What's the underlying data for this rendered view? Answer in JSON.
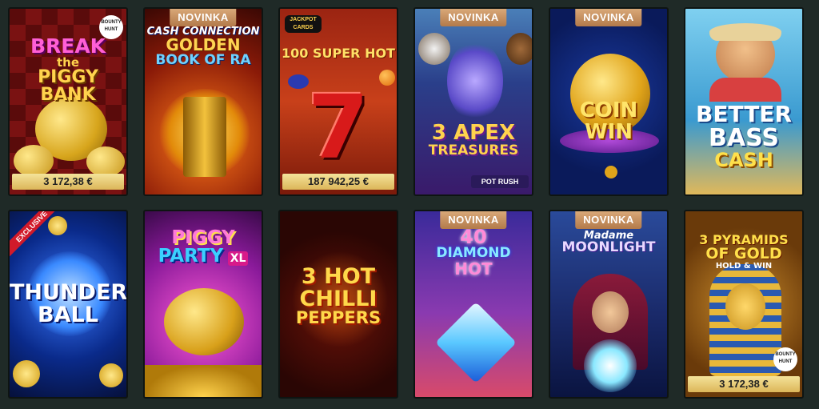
{
  "games": [
    {
      "title": "BREAK the PIGGY BANK",
      "badge": "",
      "jackpot": "3 172,38 €",
      "logo": "BOUNTY HUNT"
    },
    {
      "title": "CASH CONNECTION GOLDEN BOOK OF RA",
      "badge": "NOVINKA",
      "jackpot": "",
      "logo": ""
    },
    {
      "title": "100 SUPER HOT",
      "badge": "",
      "jackpot": "187 942,25 €",
      "logo": "JACKPOT CARDS"
    },
    {
      "title": "3 APEX TREASURES",
      "badge": "NOVINKA",
      "jackpot": "",
      "logo": "POT RUSH"
    },
    {
      "title": "COIN WIN",
      "badge": "NOVINKA",
      "jackpot": "",
      "logo": ""
    },
    {
      "title": "BETTER BASS CASH",
      "badge": "",
      "jackpot": "",
      "logo": ""
    },
    {
      "title": "THUNDER BALL",
      "badge": "",
      "jackpot": "",
      "logo": "",
      "ribbon": "EXCLUSIVE"
    },
    {
      "title": "PIGGY PARTY XL",
      "badge": "",
      "jackpot": "",
      "logo": ""
    },
    {
      "title": "3 HOT CHILLI PEPPERS",
      "badge": "",
      "jackpot": "",
      "logo": ""
    },
    {
      "title": "40 DIAMOND HOT",
      "badge": "NOVINKA",
      "jackpot": "",
      "logo": ""
    },
    {
      "title": "Madame MOONLIGHT",
      "badge": "NOVINKA",
      "jackpot": "",
      "logo": ""
    },
    {
      "title": "3 PYRAMIDS OF GOLD HOLD & WIN",
      "badge": "",
      "jackpot": "3 172,38 €",
      "logo": "BOUNTY HUNT"
    }
  ],
  "texts": {
    "g0_line1": "BREAK",
    "g0_line2": "the",
    "g0_line3": "PIGGY BANK",
    "g0_logo": "BOUNTY HUNT",
    "g1_line1": "CASH CONNECTION",
    "g1_line2": "GOLDEN",
    "g1_line3": "BOOK OF RA",
    "g2_logo": "JACKPOT CARDS",
    "g2_line1": "100 SUPER HOT",
    "g2_seven": "7",
    "g3_line1": "3 APEX",
    "g3_line2": "TREASURES",
    "g3_logo": "POT RUSH",
    "g4_line1": "COIN",
    "g4_line2": "WIN",
    "g5_line1": "BETTER",
    "g5_line2": "BASS",
    "g5_line3": "CASH",
    "g6_ribbon": "EXCLUSIVE",
    "g6_line1": "THUNDER",
    "g6_line2": "BALL",
    "g7_line1": "PIGGY",
    "g7_line2": "PARTY",
    "g7_line3": "XL",
    "g8_line1": "3 HOT",
    "g8_line2": "CHILLI",
    "g8_line3": "PEPPERS",
    "g9_line1": "40",
    "g9_line2": "DIAMOND",
    "g9_line3": "HOT",
    "g10_line1": "Madame",
    "g10_line2": "MOONLIGHT",
    "g11_line1": "3 PYRAMIDS",
    "g11_line2": "OF GOLD",
    "g11_line3": "HOLD & WIN",
    "g11_logo": "BOUNTY HUNT"
  },
  "colors": {
    "page_bg": "#1f2a27",
    "badge": "#c48f5e",
    "jackpot_bar": "#efd98a"
  }
}
